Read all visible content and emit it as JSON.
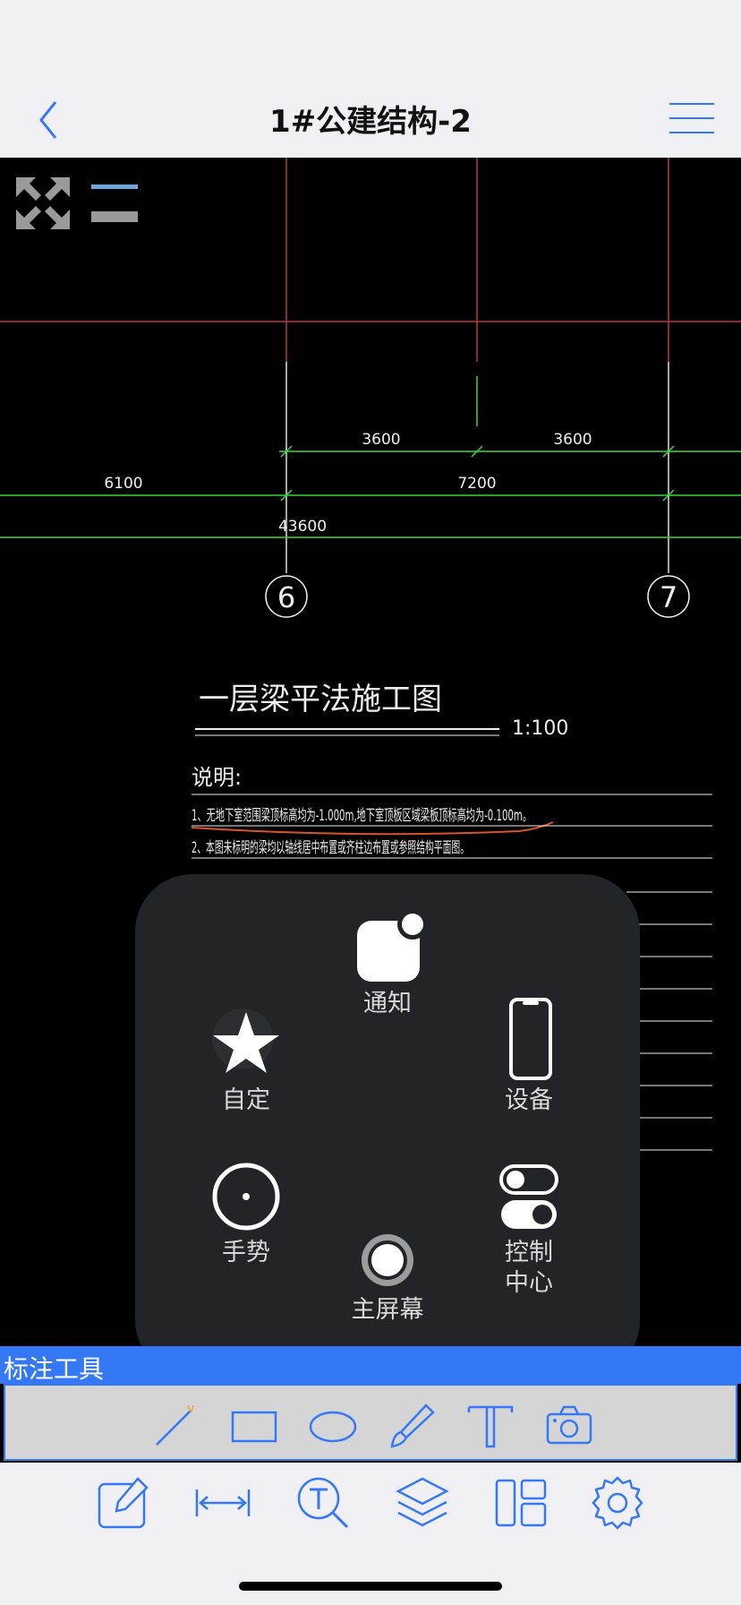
{
  "nav": {
    "title": "1#公建结构-2"
  },
  "drawing": {
    "dimensions": {
      "d1": "3600",
      "d2": "3600",
      "d3": "6100",
      "d4": "7200",
      "d5": "43600"
    },
    "axis_labels": {
      "a6": "6",
      "a7": "7"
    },
    "title": "一层梁平法施工图",
    "scale": "1:100",
    "notes_heading": "说明:",
    "note1": "1、无地下室范围梁顶标高均为-1.000m,地下室顶板区域梁板顶标高均为-0.100m。",
    "note2": "2、本图未标明的梁均以轴线居中布置或齐柱边布置或参照结构平面图。"
  },
  "assistive_menu": {
    "notification": "通知",
    "custom": "自定",
    "device": "设备",
    "gesture": "手势",
    "control_center_line1": "控制",
    "control_center_line2": "中心",
    "home": "主屏幕"
  },
  "annotation_tools": {
    "title": "标注工具"
  },
  "colors": {
    "accent": "#3478f6",
    "cad_green": "#3cd63c",
    "cad_red": "#b13a3a",
    "menu_bg": "#232427"
  }
}
